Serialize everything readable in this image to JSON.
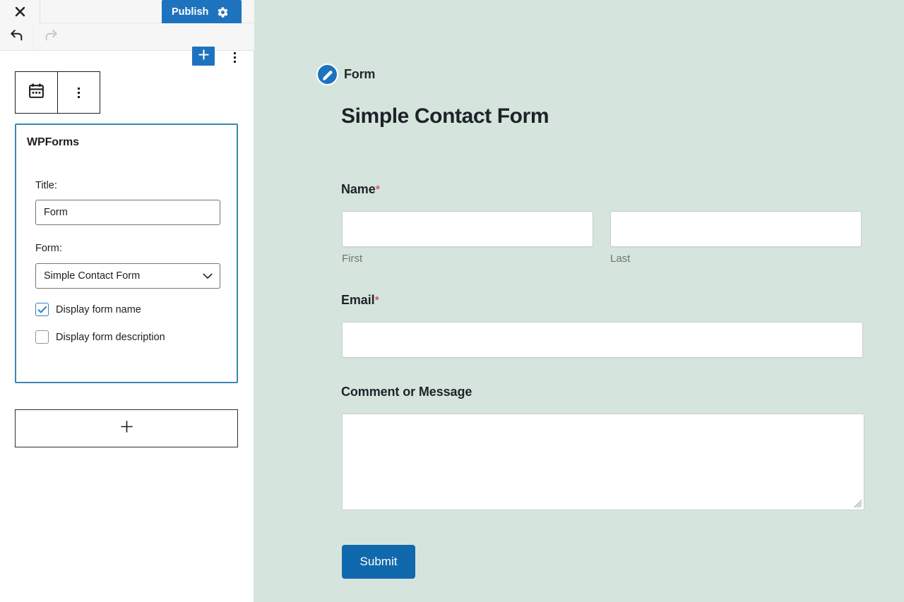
{
  "editor": {
    "topbar": {
      "close_icon": "close-icon",
      "publish_label": "Publish",
      "settings_icon": "gear-icon"
    },
    "toolbar": {
      "undo_icon": "undo-icon",
      "redo_icon": "redo-icon",
      "add_block_icon": "plus-icon",
      "more_options_icon": "ellipsis-vertical-icon"
    },
    "block_toolbar": {
      "block_type_icon": "calendar-form-icon",
      "more_icon": "ellipsis-vertical-icon"
    },
    "block_panel": {
      "title": "WPForms",
      "title_field": {
        "label": "Title:",
        "value": "Form",
        "placeholder": ""
      },
      "form_field": {
        "label": "Form:",
        "selected": "Simple Contact Form",
        "options": [
          "Simple Contact Form"
        ],
        "chevron_icon": "chevron-down-icon"
      },
      "checkboxes": [
        {
          "label": "Display form name",
          "checked": true
        },
        {
          "label": "Display form description",
          "checked": false
        }
      ]
    },
    "add_block_placeholder": {
      "icon": "plus-icon"
    }
  },
  "preview": {
    "block_badge": {
      "icon": "pencil-edit-icon",
      "label": "Form"
    },
    "form_title": "Simple Contact Form",
    "fields": [
      {
        "label": "Name",
        "required": true,
        "required_marker": "*",
        "sublabels": [
          "First",
          "Last"
        ]
      },
      {
        "label": "Email",
        "required": true,
        "required_marker": "*"
      },
      {
        "label": "Comment or Message",
        "required": false
      }
    ],
    "submit_label": "Submit"
  },
  "colors": {
    "accent_blue": "#1e73be",
    "submit_blue": "#1169ad",
    "block_selected_border": "#3b86b2",
    "preview_background": "#d6e4de",
    "required_red": "#d63638"
  }
}
